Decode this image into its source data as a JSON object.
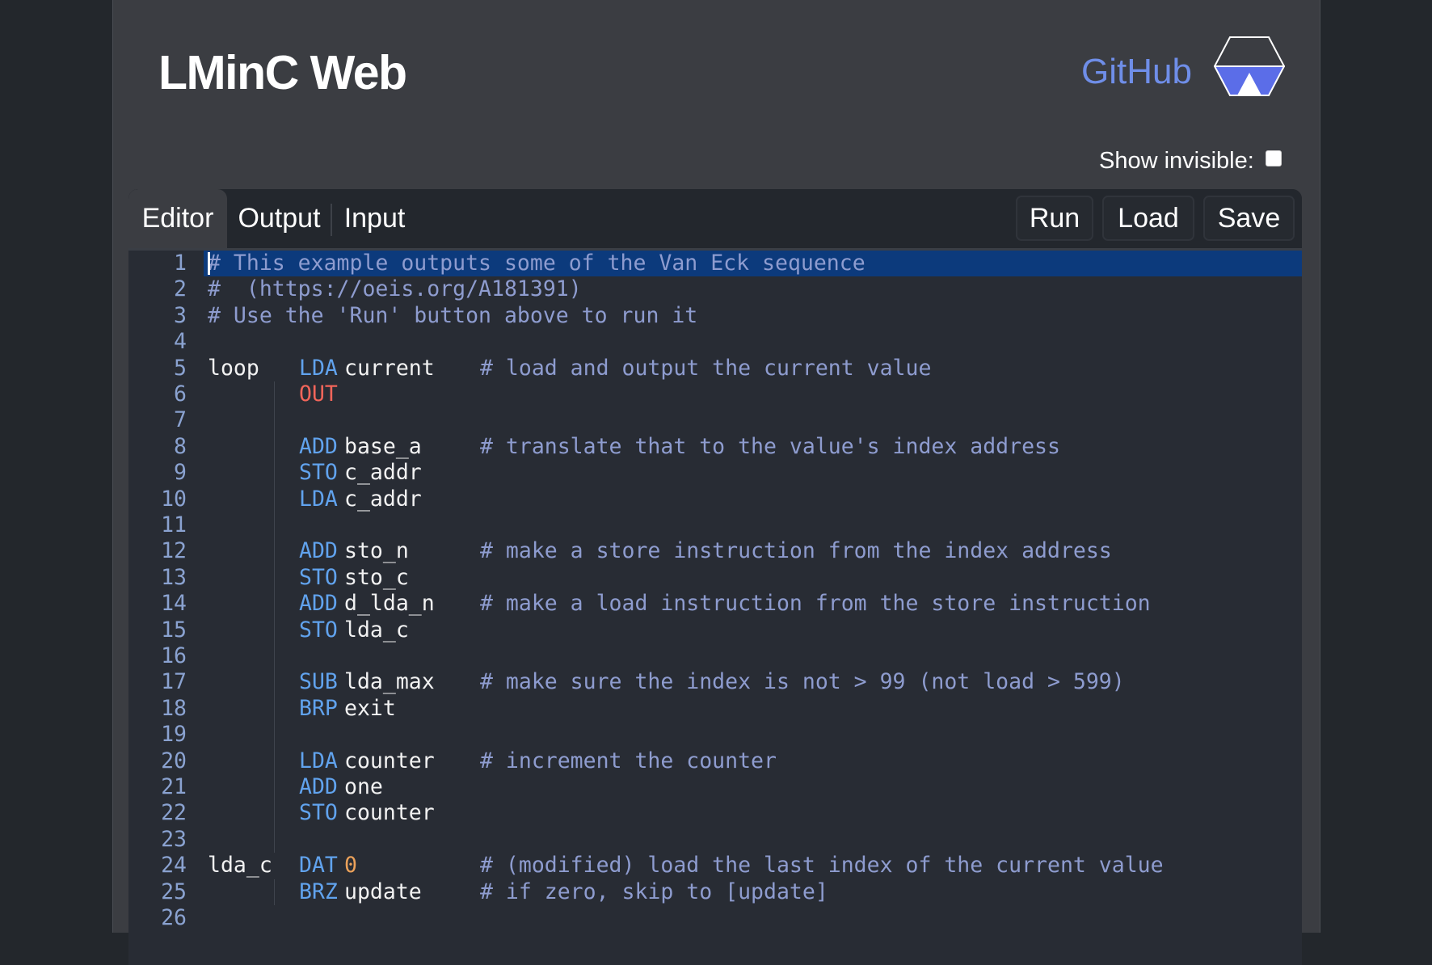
{
  "app": {
    "title": "LMinC Web",
    "github_label": "GitHub"
  },
  "colors": {
    "background": "#23272c",
    "page": "#3b3d42",
    "editor_bg": "#282c34",
    "accent_link": "#6f8ee8",
    "logo_fill": "#5b6de8",
    "active_line": "#0c3a7c",
    "opcode": "#61a3ee",
    "out_opcode": "#f2655a",
    "number": "#eba15a",
    "comment": "#8e9ccf"
  },
  "options": {
    "show_invisible_label": "Show invisible:",
    "show_invisible_checked": false
  },
  "tabs": [
    {
      "label": "Editor",
      "active": true
    },
    {
      "label": "Output",
      "active": false
    },
    {
      "label": "Input",
      "active": false
    }
  ],
  "toolbar": {
    "run_label": "Run",
    "load_label": "Load",
    "save_label": "Save"
  },
  "editor": {
    "active_line": 1,
    "lines": [
      {
        "n": "1",
        "label": "",
        "op": "",
        "arg": "",
        "comment": "# This example outputs some of the Van Eck sequence",
        "full_comment": true
      },
      {
        "n": "2",
        "label": "",
        "op": "",
        "arg": "",
        "comment": "#  (https://oeis.org/A181391)",
        "full_comment": true
      },
      {
        "n": "3",
        "label": "",
        "op": "",
        "arg": "",
        "comment": "# Use the 'Run' button above to run it",
        "full_comment": true
      },
      {
        "n": "4",
        "label": "",
        "op": "",
        "arg": "",
        "comment": ""
      },
      {
        "n": "5",
        "label": "loop",
        "op": "LDA",
        "arg": "current",
        "comment": "# load and output the current value"
      },
      {
        "n": "6",
        "label": "",
        "op": "OUT",
        "arg": "",
        "comment": ""
      },
      {
        "n": "7",
        "label": "",
        "op": "",
        "arg": "",
        "comment": ""
      },
      {
        "n": "8",
        "label": "",
        "op": "ADD",
        "arg": "base_a",
        "comment": "# translate that to the value's index address"
      },
      {
        "n": "9",
        "label": "",
        "op": "STO",
        "arg": "c_addr",
        "comment": ""
      },
      {
        "n": "10",
        "label": "",
        "op": "LDA",
        "arg": "c_addr",
        "comment": ""
      },
      {
        "n": "11",
        "label": "",
        "op": "",
        "arg": "",
        "comment": ""
      },
      {
        "n": "12",
        "label": "",
        "op": "ADD",
        "arg": "sto_n",
        "comment": "# make a store instruction from the index address"
      },
      {
        "n": "13",
        "label": "",
        "op": "STO",
        "arg": "sto_c",
        "comment": ""
      },
      {
        "n": "14",
        "label": "",
        "op": "ADD",
        "arg": "d_lda_n",
        "comment": "# make a load instruction from the store instruction"
      },
      {
        "n": "15",
        "label": "",
        "op": "STO",
        "arg": "lda_c",
        "comment": ""
      },
      {
        "n": "16",
        "label": "",
        "op": "",
        "arg": "",
        "comment": ""
      },
      {
        "n": "17",
        "label": "",
        "op": "SUB",
        "arg": "lda_max",
        "comment": "# make sure the index is not > 99 (not load > 599)"
      },
      {
        "n": "18",
        "label": "",
        "op": "BRP",
        "arg": "exit",
        "comment": ""
      },
      {
        "n": "19",
        "label": "",
        "op": "",
        "arg": "",
        "comment": ""
      },
      {
        "n": "20",
        "label": "",
        "op": "LDA",
        "arg": "counter",
        "comment": "# increment the counter"
      },
      {
        "n": "21",
        "label": "",
        "op": "ADD",
        "arg": "one",
        "comment": ""
      },
      {
        "n": "22",
        "label": "",
        "op": "STO",
        "arg": "counter",
        "comment": ""
      },
      {
        "n": "23",
        "label": "",
        "op": "",
        "arg": "",
        "comment": ""
      },
      {
        "n": "24",
        "label": "lda_c",
        "op": "DAT",
        "arg": "0",
        "arg_numeric": true,
        "comment": "# (modified) load the last index of the current value"
      },
      {
        "n": "25",
        "label": "",
        "op": "BRZ",
        "arg": "update",
        "comment": "# if zero, skip to [update]"
      },
      {
        "n": "26",
        "label": "",
        "op": "",
        "arg": "",
        "comment": ""
      }
    ]
  }
}
